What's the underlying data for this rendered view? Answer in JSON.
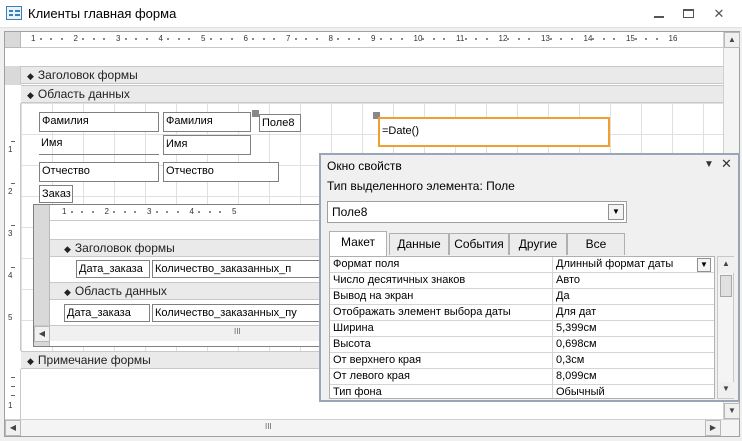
{
  "window": {
    "title": "Клиенты главная форма"
  },
  "ruler": {
    "main_numbers": [
      "1",
      "2",
      "3",
      "4",
      "5",
      "6",
      "7",
      "8",
      "9",
      "10",
      "11",
      "12",
      "13",
      "14",
      "15",
      "16"
    ],
    "sub_numbers": [
      "1",
      "2",
      "3",
      "4",
      "5"
    ],
    "vertical_numbers": [
      "1",
      "2",
      "3",
      "4",
      "5",
      "1"
    ]
  },
  "form": {
    "sections": {
      "header": "Заголовок формы",
      "detail": "Область данных",
      "footer": "Примечание формы"
    },
    "controls": {
      "label_lastname": "Фамилия",
      "field_lastname": "Фамилия",
      "label_field8": "Поле8",
      "field8_value": "=Date()",
      "label_firstname": "Имя",
      "field_firstname": "Имя",
      "label_patronymic": "Отчество",
      "field_patronymic": "Отчество",
      "label_order": "Заказ"
    },
    "subform": {
      "sections": {
        "header": "Заголовок формы",
        "detail": "Область данных"
      },
      "header_labels": [
        "Дата_заказа",
        "Количество_заказанных_п"
      ],
      "detail_fields": [
        "Дата_заказа",
        "Количество_заказанных_пу"
      ],
      "scroll_mark": "III"
    }
  },
  "bottom_scroll_mark": "III",
  "property_sheet": {
    "title": "Окно свойств",
    "selection_type": "Тип выделенного элемента:  Поле",
    "selected_object": "Поле8",
    "tabs": [
      "Макет",
      "Данные",
      "События",
      "Другие",
      "Все"
    ],
    "active_tab": "Макет",
    "properties": [
      {
        "name": "Формат поля",
        "value": "Длинный формат даты"
      },
      {
        "name": "Число десятичных знаков",
        "value": "Авто"
      },
      {
        "name": "Вывод на экран",
        "value": "Да"
      },
      {
        "name": "Отображать элемент выбора даты",
        "value": "Для дат"
      },
      {
        "name": "Ширина",
        "value": "5,399см"
      },
      {
        "name": "Высота",
        "value": "0,698см"
      },
      {
        "name": "От верхнего края",
        "value": "0,3см"
      },
      {
        "name": "От левого края",
        "value": "8,099см"
      },
      {
        "name": "Тип фона",
        "value": "Обычный"
      }
    ]
  },
  "colors": {
    "selection_border": "#f0a030",
    "property_sheet_border": "#9aa6b5"
  },
  "icons": [
    "form-icon",
    "minimize-icon",
    "restore-icon",
    "close-icon",
    "section-arrow-icon",
    "dropdown-icon",
    "scroll-up-icon",
    "scroll-down-icon",
    "scroll-left-icon",
    "scroll-right-icon"
  ]
}
